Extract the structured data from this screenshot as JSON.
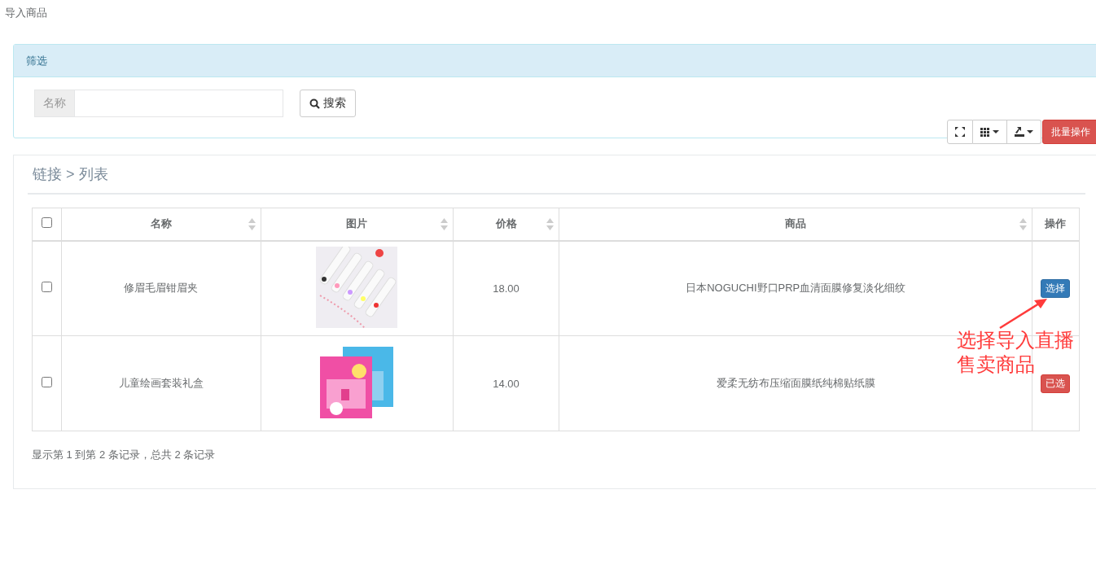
{
  "page_title": "导入商品",
  "filter": {
    "title": "筛选",
    "field_label": "名称",
    "search_button": "搜索"
  },
  "toolbar": {
    "batch_button": "批量操作"
  },
  "breadcrumb": "链接 > 列表",
  "table": {
    "select_all": {
      "checked": false
    },
    "columns": [
      {
        "label": "名称",
        "sortable": true
      },
      {
        "label": "图片",
        "sortable": true
      },
      {
        "label": "价格",
        "sortable": true
      },
      {
        "label": "商品",
        "sortable": true
      },
      {
        "label": "操作",
        "sortable": false
      }
    ],
    "rows": [
      {
        "checked": false,
        "name": "修眉毛眉钳眉夹",
        "price": "18.00",
        "product": "日本NOGUCHI野口PRP血清面膜修复淡化细纹",
        "action": {
          "label": "选择",
          "selected": false
        }
      },
      {
        "checked": false,
        "name": "儿童绘画套装礼盒",
        "price": "14.00",
        "product": "爱柔无纺布压缩面膜纸纯棉贴纸膜",
        "action": {
          "label": "已选",
          "selected": true
        }
      }
    ]
  },
  "pagination_info": "显示第 1 到第 2 条记录，总共 2 条记录",
  "annotation": {
    "text_lines": [
      "选择导入直播",
      "售卖商品"
    ]
  }
}
